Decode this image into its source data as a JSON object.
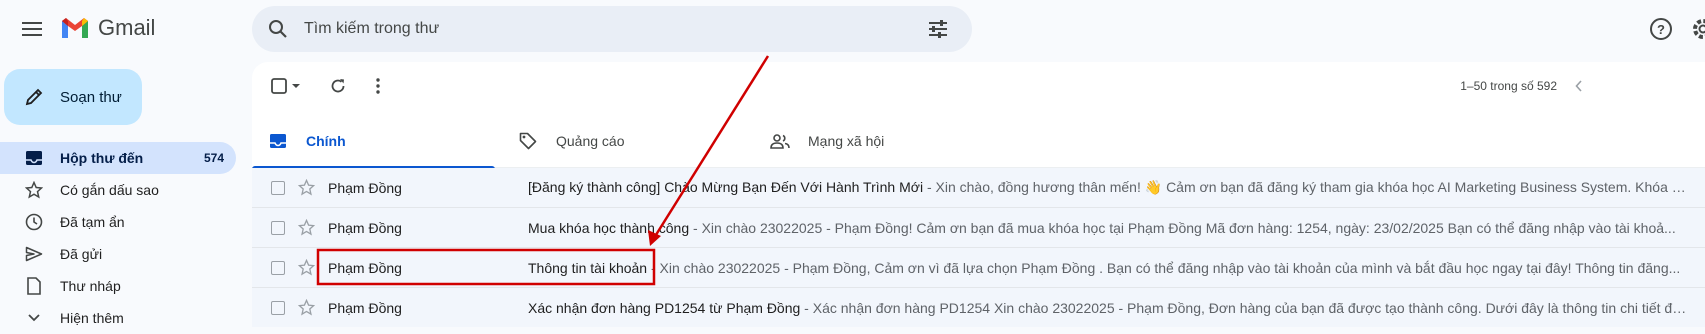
{
  "app": {
    "name": "Gmail"
  },
  "search": {
    "placeholder": "Tìm kiếm trong thư"
  },
  "compose": {
    "label": "Soạn thư"
  },
  "sidebar": {
    "items": [
      {
        "label": "Hộp thư đến",
        "count": "574",
        "icon": "inbox-icon",
        "active": true
      },
      {
        "label": "Có gắn dấu sao",
        "count": "",
        "icon": "star-icon"
      },
      {
        "label": "Đã tạm ẩn",
        "count": "",
        "icon": "clock-icon"
      },
      {
        "label": "Đã gửi",
        "count": "",
        "icon": "send-icon"
      },
      {
        "label": "Thư nháp",
        "count": "",
        "icon": "draft-icon"
      },
      {
        "label": "Hiện thêm",
        "count": "",
        "icon": "chevron-down-icon"
      }
    ]
  },
  "toolbar": {
    "pager": "1–50 trong số 592"
  },
  "tabs": [
    {
      "label": "Chính",
      "icon": "inbox-icon",
      "active": true
    },
    {
      "label": "Quảng cáo",
      "icon": "tag-icon"
    },
    {
      "label": "Mạng xã hội",
      "icon": "people-icon"
    }
  ],
  "emails": [
    {
      "sender": "Phạm Đồng",
      "subject": "[Đăng ký thành công] Chào Mừng Bạn Đến Với Hành Trình Mới",
      "snippet": " - Xin chào, đồng hương thân mến! 👋 Cảm ơn bạn đã đăng ký tham gia khóa học AI Marketing Business System. Khóa h..."
    },
    {
      "sender": "Phạm Đồng",
      "subject": "Mua khóa học thành công",
      "snippet": " - Xin chào 23022025 - Phạm Đồng! Cảm ơn bạn đã mua khóa học tại Phạm Đồng Mã đơn hàng: 1254, ngày: 23/02/2025 Bạn có thể đăng nhập vào tài khoả..."
    },
    {
      "sender": "Phạm Đồng",
      "subject": "Thông tin tài khoản",
      "snippet": " - Xin chào 23022025 - Phạm Đồng, Cảm ơn vì đã lựa chọn Phạm Đồng . Bạn có thể đăng nhập vào tài khoản của mình và bắt đầu học ngay tại đây! Thông tin đăng..."
    },
    {
      "sender": "Phạm Đồng",
      "subject": "Xác nhận đơn hàng PD1254 từ Phạm Đồng",
      "snippet": " - Xác nhận đơn hàng PD1254 Xin chào 23022025 - Phạm Đồng, Đơn hàng của bạn đã được tạo thành công. Dưới đây là thông tin chi tiết đơ..."
    }
  ],
  "colors": {
    "annotation": "#d00000",
    "active_tab": "#0b57d0",
    "compose_bg": "#c2e7ff"
  }
}
